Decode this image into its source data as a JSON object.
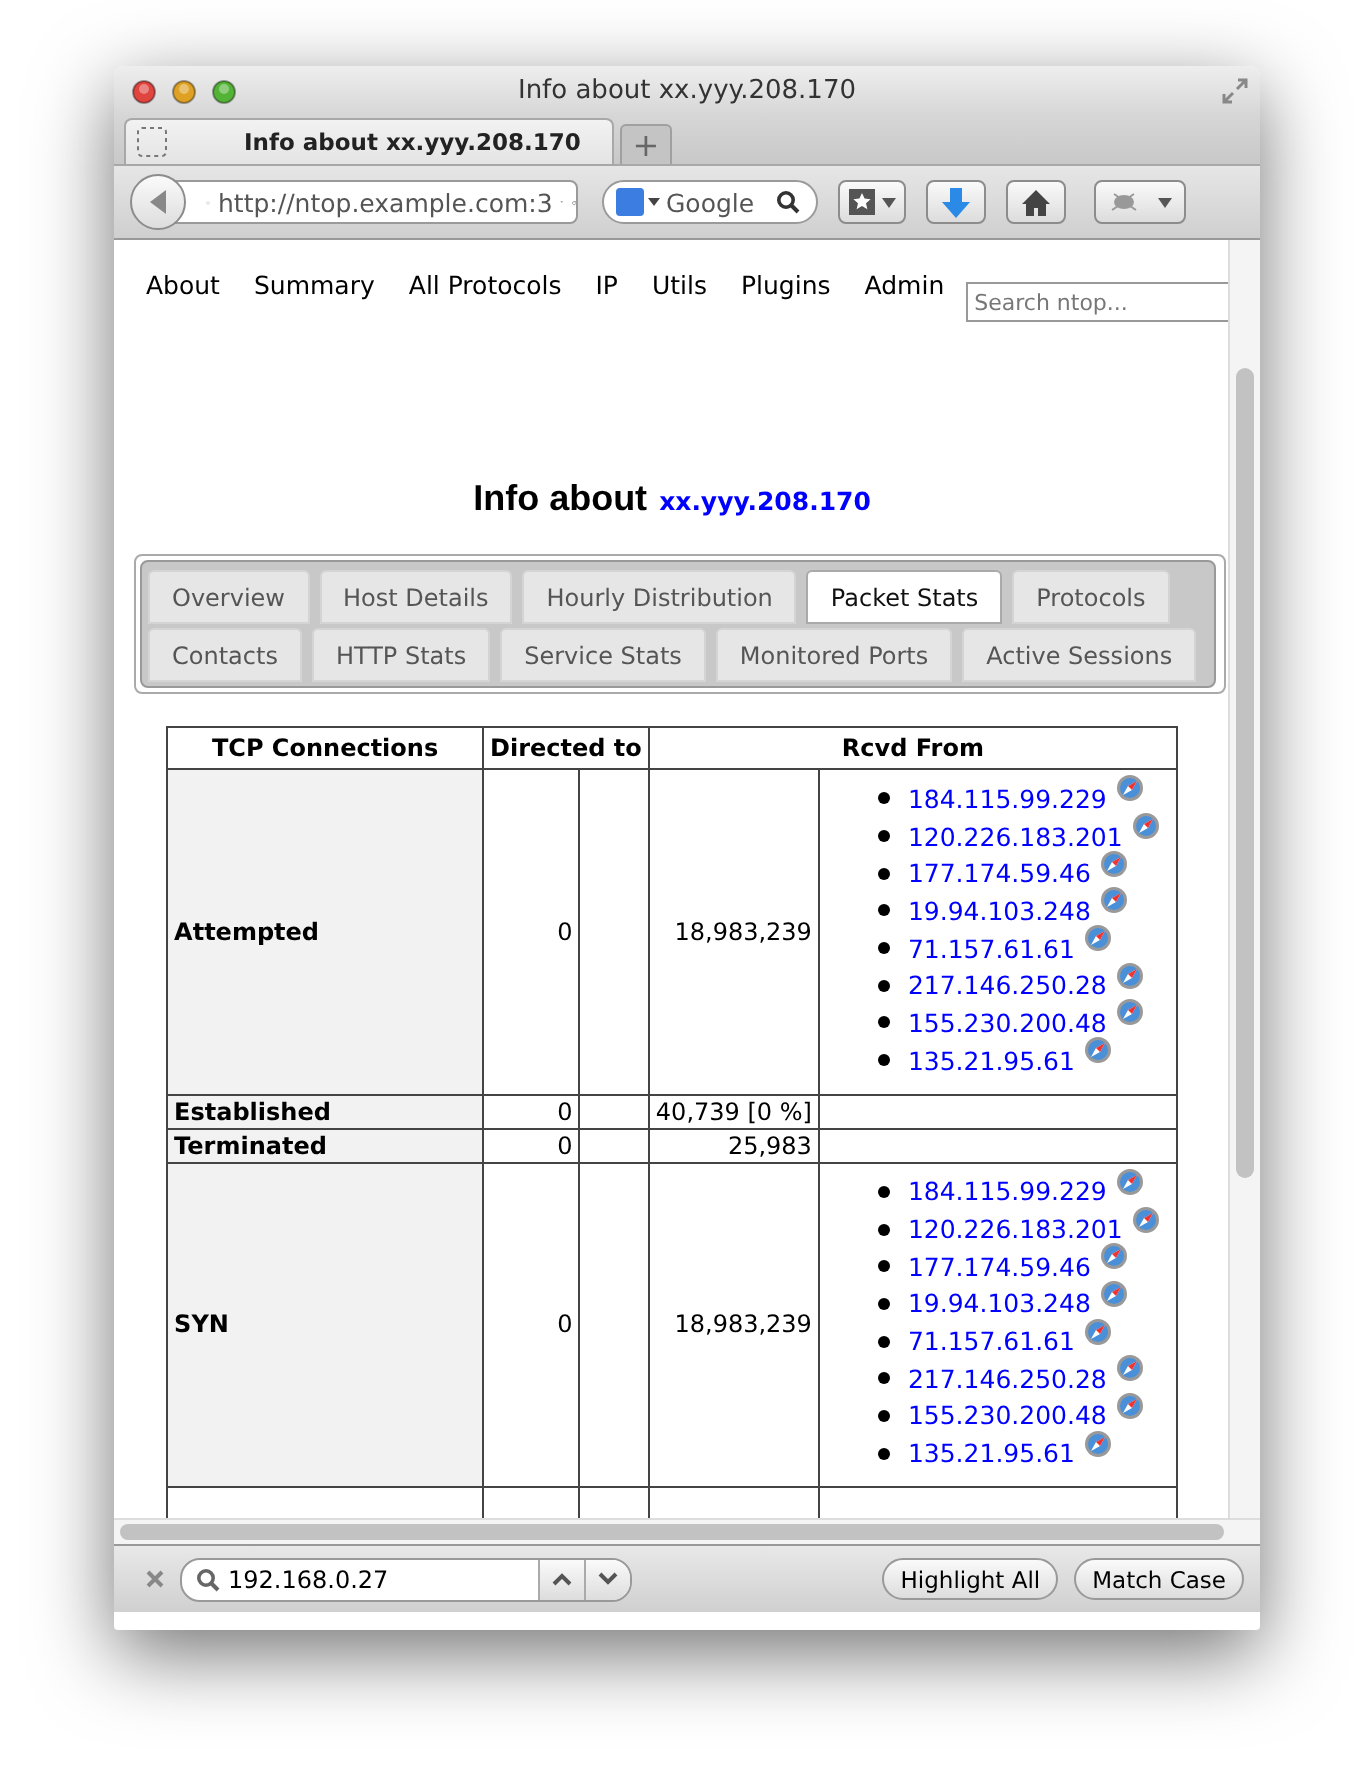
{
  "window": {
    "title": "Info about xx.yyy.208.170"
  },
  "browser_tabs": [
    {
      "label": "Info about xx.yyy.208.170",
      "selected": true
    }
  ],
  "new_tab": "+",
  "address_bar": {
    "value": "http://ntop.example.com:3"
  },
  "web_search": {
    "placeholder": "Google"
  },
  "nav_menu": [
    "About",
    "Summary",
    "All Protocols",
    "IP",
    "Utils",
    "Plugins",
    "Admin"
  ],
  "site_search": {
    "placeholder": "Search ntop..."
  },
  "heading": {
    "text": "Info about",
    "host": "xx.yyy.208.170"
  },
  "tabs": [
    {
      "label": "Overview",
      "selected": false
    },
    {
      "label": "Host Details",
      "selected": false
    },
    {
      "label": "Hourly Distribution",
      "selected": false
    },
    {
      "label": "Packet Stats",
      "selected": true
    },
    {
      "label": "Protocols",
      "selected": false
    },
    {
      "label": "Contacts",
      "selected": false
    },
    {
      "label": "HTTP Stats",
      "selected": false
    },
    {
      "label": "Service Stats",
      "selected": false
    },
    {
      "label": "Monitored Ports",
      "selected": false
    },
    {
      "label": "Active Sessions",
      "selected": false
    }
  ],
  "table": {
    "columns": [
      "TCP Connections",
      "Directed to",
      "Rcvd From"
    ],
    "rows": [
      {
        "label": "Attempted",
        "directed_to": "0",
        "rcvd_from": "18,983,239",
        "hosts": [
          "184.115.99.229",
          "120.226.183.201",
          "177.174.59.46",
          "19.94.103.248",
          "71.157.61.61",
          "217.146.250.28",
          "155.230.200.48",
          "135.21.95.61"
        ]
      },
      {
        "label": "Established",
        "directed_to": "0",
        "rcvd_from": "40,739 [0 %]"
      },
      {
        "label": "Terminated",
        "directed_to": "0",
        "rcvd_from": "25,983"
      },
      {
        "label": "SYN",
        "directed_to": "0",
        "rcvd_from": "18,983,239",
        "hosts": [
          "184.115.99.229",
          "120.226.183.201",
          "177.174.59.46",
          "19.94.103.248",
          "71.157.61.61",
          "217.146.250.28",
          "155.230.200.48",
          "135.21.95.61"
        ]
      }
    ]
  },
  "find_bar": {
    "value": "192.168.0.27",
    "buttons": [
      "Highlight All",
      "Match Case"
    ]
  }
}
